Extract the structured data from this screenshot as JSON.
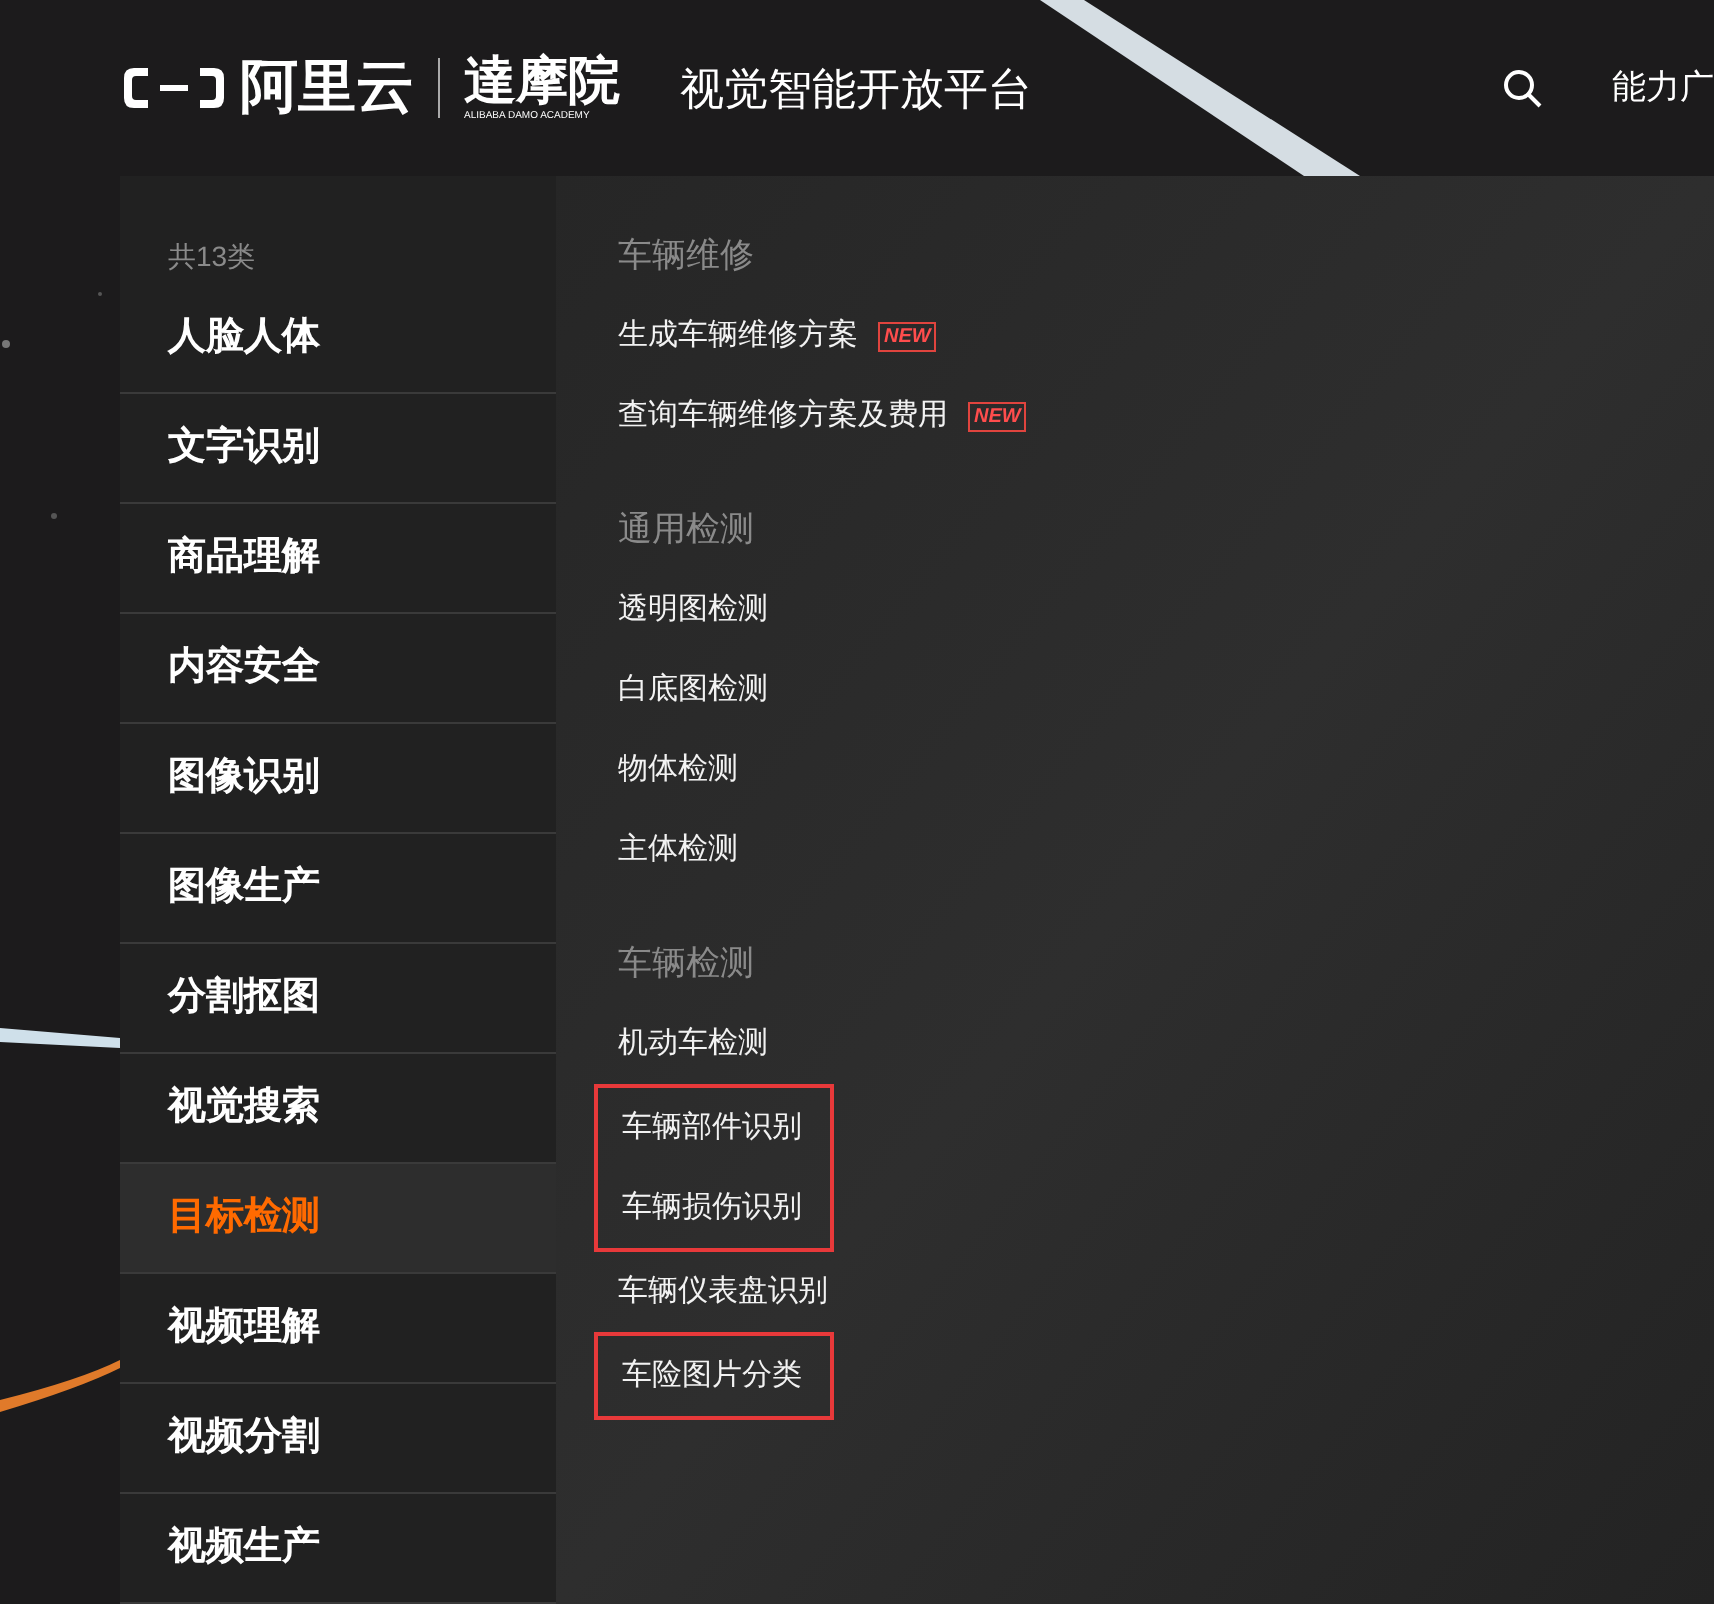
{
  "header": {
    "logo_text": "阿里云",
    "academy_name": "達摩院",
    "academy_subtitle": "ALIBABA DAMO ACADEMY",
    "platform_title": "视觉智能开放平台",
    "nav_link": "能力广"
  },
  "sidebar": {
    "count_label": "共13类",
    "items": [
      {
        "label": "人脸人体",
        "selected": false
      },
      {
        "label": "文字识别",
        "selected": false
      },
      {
        "label": "商品理解",
        "selected": false
      },
      {
        "label": "内容安全",
        "selected": false
      },
      {
        "label": "图像识别",
        "selected": false
      },
      {
        "label": "图像生产",
        "selected": false
      },
      {
        "label": "分割抠图",
        "selected": false
      },
      {
        "label": "视觉搜索",
        "selected": false
      },
      {
        "label": "目标检测",
        "selected": true
      },
      {
        "label": "视频理解",
        "selected": false
      },
      {
        "label": "视频分割",
        "selected": false
      },
      {
        "label": "视频生产",
        "selected": false
      }
    ]
  },
  "sections": [
    {
      "title": "车辆维修",
      "items": [
        {
          "label": "生成车辆维修方案",
          "badge": "NEW",
          "marked": false
        },
        {
          "label": "查询车辆维修方案及费用",
          "badge": "NEW",
          "marked": false
        }
      ]
    },
    {
      "title": "通用检测",
      "items": [
        {
          "label": "透明图检测",
          "marked": false
        },
        {
          "label": "白底图检测",
          "marked": false
        },
        {
          "label": "物体检测",
          "marked": false
        },
        {
          "label": "主体检测",
          "marked": false
        }
      ]
    },
    {
      "title": "车辆检测",
      "items": [
        {
          "label": "机动车检测",
          "marked": false
        },
        {
          "label": "车辆部件识别",
          "marked": true
        },
        {
          "label": "车辆损伤识别",
          "marked": true
        },
        {
          "label": "车辆仪表盘识别",
          "marked": false
        },
        {
          "label": "车险图片分类",
          "marked": true
        }
      ]
    }
  ]
}
